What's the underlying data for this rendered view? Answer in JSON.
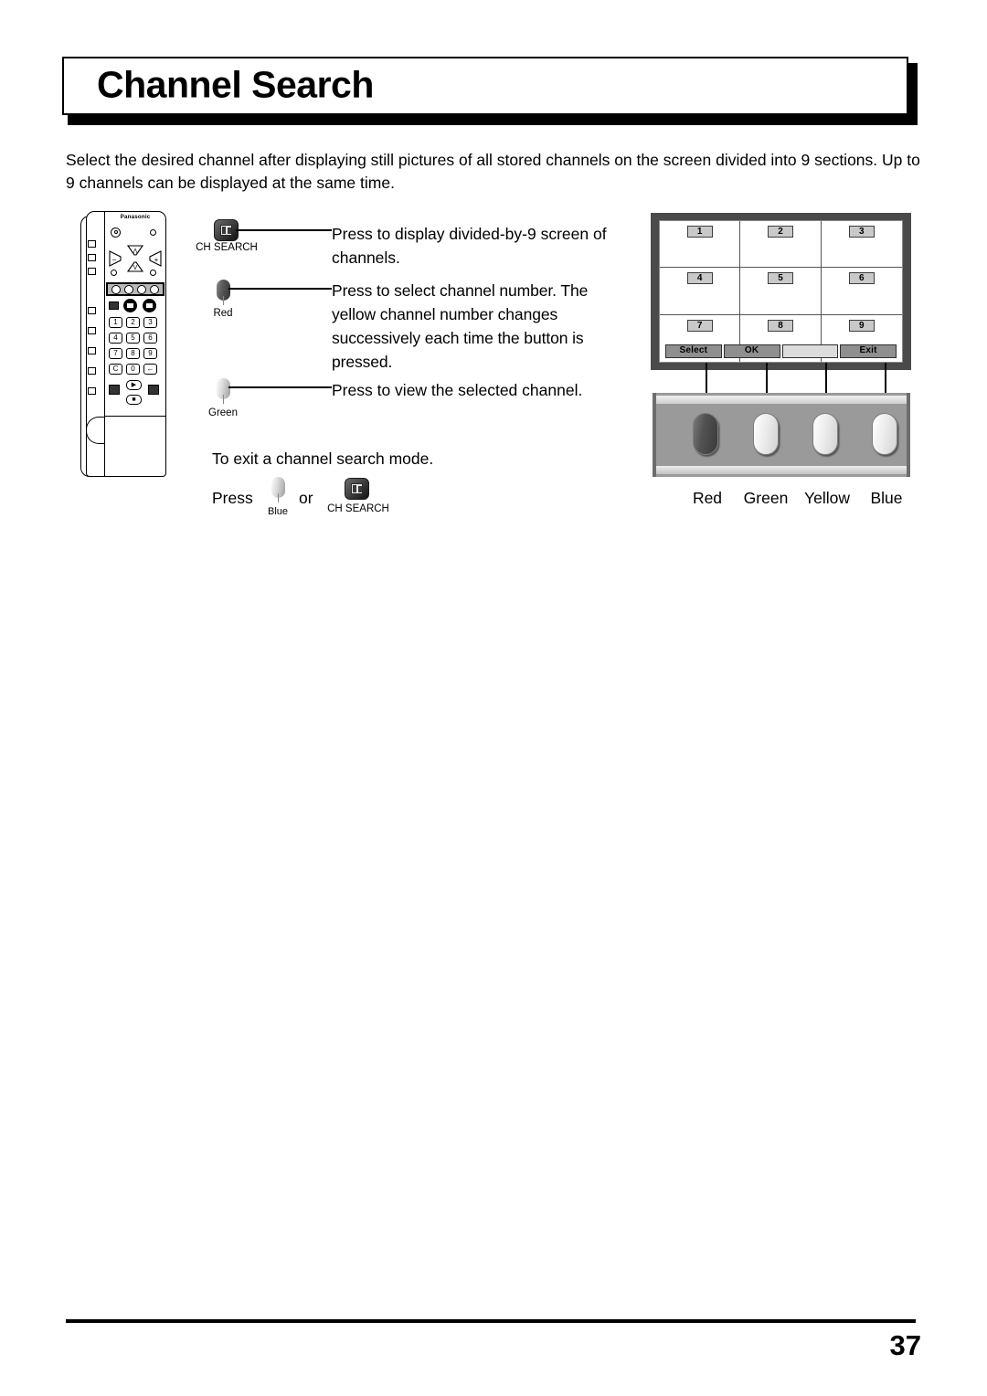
{
  "page": {
    "title": "Channel Search",
    "number": "37",
    "intro": "Select the desired channel after displaying still pictures of all stored channels on the screen divided into 9 sections. Up to 9 channels can be displayed at the same time."
  },
  "remote": {
    "brand": "Panasonic",
    "keypad": [
      "1",
      "2",
      "3",
      "4",
      "5",
      "6",
      "7",
      "8",
      "9",
      "C",
      "0",
      "←"
    ]
  },
  "callouts": [
    {
      "icon": "ch-search-icon",
      "label": "CH SEARCH",
      "text": "Press to display divided-by-9 screen of channels."
    },
    {
      "icon": "red-button-icon",
      "label": "Red",
      "text": "Press to select channel number. The yellow channel number changes successively each time the button is pressed."
    },
    {
      "icon": "green-button-icon",
      "label": "Green",
      "text": "Press to view the selected channel."
    }
  ],
  "exit_section": {
    "heading": "To exit a channel search mode.",
    "press_label": "Press",
    "or_label": "or",
    "blue_label": "Blue",
    "ch_search_label": "CH SEARCH"
  },
  "tv": {
    "channels": [
      "1",
      "2",
      "3",
      "4",
      "5",
      "6",
      "7",
      "8",
      "9"
    ],
    "osd_bar": [
      "Select",
      "OK",
      "",
      "Exit"
    ]
  },
  "color_panel": {
    "buttons": [
      {
        "label": "Red",
        "style": "dark"
      },
      {
        "label": "Green",
        "style": "light"
      },
      {
        "label": "Yellow",
        "style": "light"
      },
      {
        "label": "Blue",
        "style": "light"
      }
    ]
  },
  "colors": {
    "tv_frame": "#4a4a4a",
    "panel_gray": "#9a9a9a",
    "osd_segment": "#8f8f8f",
    "osd_blank": "#dcdcdc",
    "badge": "#c9c9c9"
  }
}
